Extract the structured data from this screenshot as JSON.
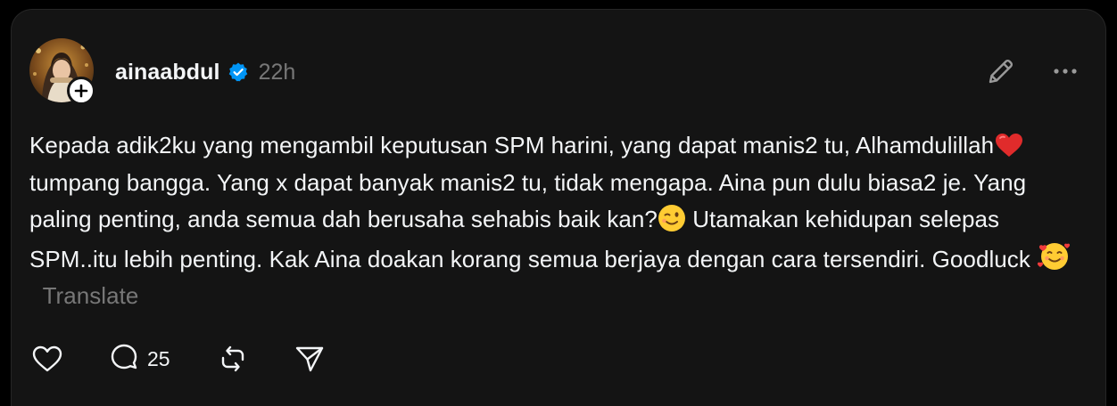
{
  "post": {
    "username": "ainaabdul",
    "timestamp": "22h",
    "verified": true,
    "text": {
      "p1": "Kepada adik2ku yang mengambil keputusan SPM harini, yang dapat manis2 tu, Alhamdulillah",
      "emoji1": "heart-emoji",
      "p2": " tumpang bangga. Yang x dapat banyak manis2 tu, tidak mengapa. Aina pun dulu biasa2 je. Yang paling penting, anda semua dah berusaha sehabis baik kan?",
      "emoji2": "wink-emoji",
      "p3": " Utamakan kehidupan selepas SPM..itu lebih penting. Kak Aina doakan korang semua berjaya dengan cara tersendiri. Goodluck ",
      "emoji3": "smiling-face-with-hearts-emoji"
    },
    "translate_label": "Translate",
    "reply_count": "25"
  },
  "icons": {
    "edit": "pencil-icon",
    "more": "more-dots-icon",
    "like": "heart-outline-icon",
    "reply": "speech-bubble-icon",
    "repost": "repost-icon",
    "share": "send-icon",
    "follow": "plus-icon"
  },
  "colors": {
    "background": "#000000",
    "card": "#141414",
    "text_primary": "#f3f5f7",
    "text_secondary": "#777777",
    "verified_blue": "#0095f6"
  }
}
